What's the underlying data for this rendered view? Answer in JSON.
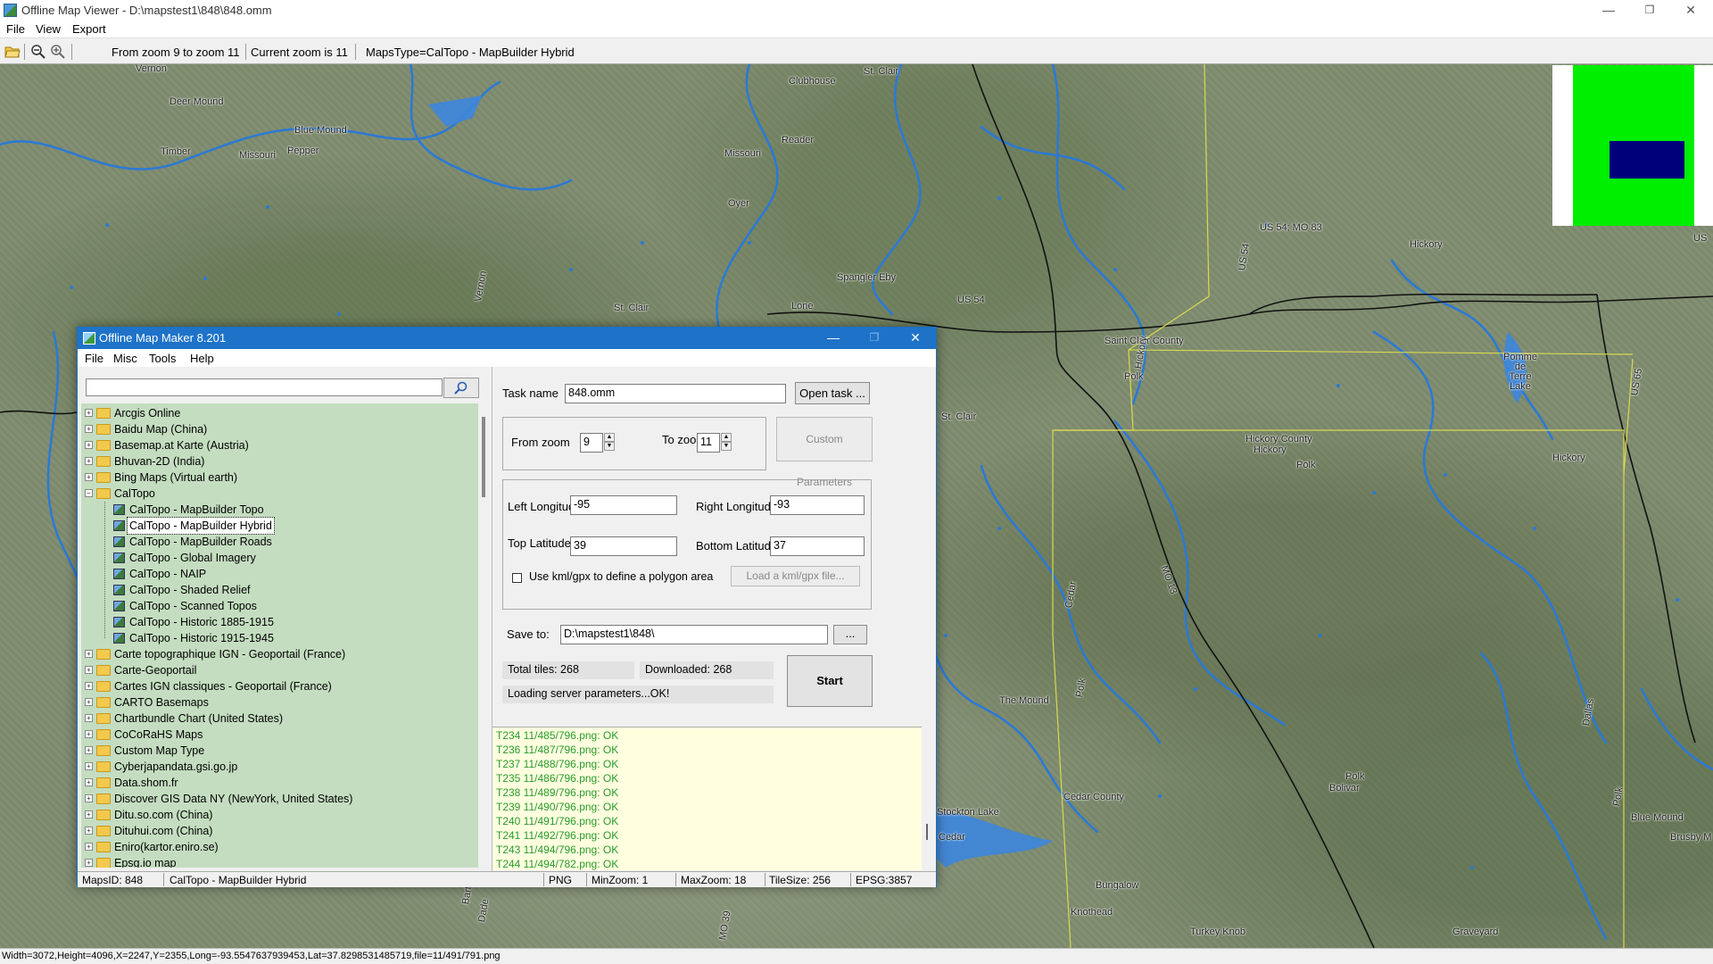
{
  "window": {
    "title": "Offline Map Viewer - D:\\mapstest1\\848\\848.omm",
    "minimize": "—",
    "maximize": "❐",
    "close": "✕"
  },
  "menu": [
    "File",
    "View",
    "Export"
  ],
  "toolbar": {
    "zoom_range": "From zoom 9 to zoom 11",
    "current_zoom": "Current zoom is 11",
    "maps_type": "MapsType=CalTopo - MapBuilder Hybrid"
  },
  "map": {
    "places": [
      "Vernon",
      "Deer Mound",
      "Blue Mound",
      "Timber",
      "Missouri",
      "Pepper",
      "Clubhouse",
      "St. Clair",
      "Reader",
      "Missouri",
      "Oyer",
      "Spangler Eby",
      "US 54",
      "St. Clair",
      "Lone",
      "US 54; MO 83",
      "US 54",
      "Hickory",
      "US",
      "Pomme de Terre Lake",
      "US 65",
      "Saint Clair County",
      "St. Clair",
      "Polk",
      "Hickory County",
      "Hickory",
      "Polk",
      "Hickory",
      "Hickory",
      "Vernon",
      "MO 13",
      "Cedar",
      "Polk",
      "The Mound",
      "Polk",
      "Bolivar",
      "Cedar County",
      "Stockton Lake",
      "Cedar",
      "Polk",
      "Blue Mound",
      "Brusby M",
      "Dallas",
      "Bungalow",
      "Knothead",
      "Turkey Knob",
      "Graveyard",
      "Dade",
      "MO 39",
      "Barton"
    ]
  },
  "statusbar": {
    "text": "Width=3072,Height=4096,X=2247,Y=2355,Long=-93.5547637939453,Lat=37.8298531485719,file=11/491/791.png"
  },
  "dialog": {
    "title": "Offline Map Maker 8.201",
    "menu": [
      "File",
      "Misc",
      "Tools",
      "Help"
    ],
    "search": {
      "value": "",
      "icon": "search-icon"
    },
    "tree": [
      {
        "label": "Arcgis Online",
        "level": 0,
        "type": "folder"
      },
      {
        "label": "Baidu Map (China)",
        "level": 0,
        "type": "folder"
      },
      {
        "label": "Basemap.at Karte (Austria)",
        "level": 0,
        "type": "folder"
      },
      {
        "label": "Bhuvan-2D (India)",
        "level": 0,
        "type": "folder"
      },
      {
        "label": "Bing Maps (Virtual earth)",
        "level": 0,
        "type": "folder"
      },
      {
        "label": "CalTopo",
        "level": 0,
        "type": "folder-open"
      },
      {
        "label": "CalTopo - MapBuilder Topo",
        "level": 1,
        "type": "map"
      },
      {
        "label": "CalTopo - MapBuilder Hybrid",
        "level": 1,
        "type": "map",
        "selected": true
      },
      {
        "label": "CalTopo - MapBuilder Roads",
        "level": 1,
        "type": "map"
      },
      {
        "label": "CalTopo - Global Imagery",
        "level": 1,
        "type": "map"
      },
      {
        "label": "CalTopo - NAIP",
        "level": 1,
        "type": "map"
      },
      {
        "label": "CalTopo - Shaded Relief",
        "level": 1,
        "type": "map"
      },
      {
        "label": "CalTopo - Scanned Topos",
        "level": 1,
        "type": "map"
      },
      {
        "label": "CalTopo - Historic 1885-1915",
        "level": 1,
        "type": "map"
      },
      {
        "label": "CalTopo - Historic 1915-1945",
        "level": 1,
        "type": "map"
      },
      {
        "label": "Carte topographique IGN - Geoportail (France)",
        "level": 0,
        "type": "folder"
      },
      {
        "label": "Carte-Geoportail",
        "level": 0,
        "type": "folder"
      },
      {
        "label": "Cartes IGN classiques - Geoportail (France)",
        "level": 0,
        "type": "folder"
      },
      {
        "label": "CARTO Basemaps",
        "level": 0,
        "type": "folder"
      },
      {
        "label": "Chartbundle Chart (United States)",
        "level": 0,
        "type": "folder"
      },
      {
        "label": "CoCoRaHS Maps",
        "level": 0,
        "type": "folder"
      },
      {
        "label": "Custom Map Type",
        "level": 0,
        "type": "folder"
      },
      {
        "label": "Cyberjapandata.gsi.go.jp",
        "level": 0,
        "type": "folder"
      },
      {
        "label": "Data.shom.fr",
        "level": 0,
        "type": "folder"
      },
      {
        "label": "Discover GIS Data NY (NewYork, United States)",
        "level": 0,
        "type": "folder"
      },
      {
        "label": "Ditu.so.com (China)",
        "level": 0,
        "type": "folder"
      },
      {
        "label": "Dituhui.com (China)",
        "level": 0,
        "type": "folder"
      },
      {
        "label": "Eniro(kartor.eniro.se)",
        "level": 0,
        "type": "folder"
      },
      {
        "label": "Epsg.io map",
        "level": 0,
        "type": "folder"
      }
    ],
    "task": {
      "label": "Task name",
      "value": "848.omm",
      "open_button": "Open task ..."
    },
    "zoom": {
      "from_label": "From zoom",
      "from_value": "9",
      "to_label": "To zoom",
      "to_value": "11",
      "custom_button": "Custom Parameters"
    },
    "coords": {
      "left_lon_label": "Left Longitude",
      "left_lon": "-95",
      "right_lon_label": "Right Longitude",
      "right_lon": "-93",
      "top_lat_label": "Top Latitude",
      "top_lat": "39",
      "bottom_lat_label": "Bottom Latitude",
      "bottom_lat": "37",
      "kml_checkbox_label": "Use kml/gpx to define a polygon area",
      "kml_button": "Load a kml/gpx file..."
    },
    "save": {
      "label": "Save to:",
      "value": "D:\\mapstest1\\848\\",
      "browse": "..."
    },
    "progress": {
      "total": "Total tiles: 268",
      "downloaded": "Downloaded: 268",
      "status": "Loading server parameters...OK!",
      "start_button": "Start"
    },
    "log": [
      "T234 11/485/796.png: OK",
      "T236 11/487/796.png: OK",
      "T237 11/488/796.png: OK",
      "T235 11/486/796.png: OK",
      "T238 11/489/796.png: OK",
      "T239 11/490/796.png: OK",
      "T240 11/491/796.png: OK",
      "T241 11/492/796.png: OK",
      "T243 11/494/796.png: OK",
      "T244 11/494/782.png: OK"
    ],
    "status": {
      "maps_id": "MapsID: 848",
      "map_name": "CalTopo - MapBuilder Hybrid",
      "format": "PNG",
      "min_zoom": "MinZoom: 1",
      "max_zoom": "MaxZoom: 18",
      "tile_size": "TileSize: 256",
      "epsg": "EPSG:3857"
    }
  }
}
